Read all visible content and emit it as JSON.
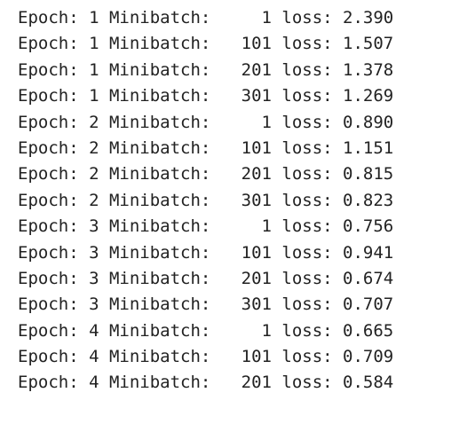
{
  "console": {
    "lines": [
      "Epoch: 1 Minibatch:     1 loss: 2.390",
      "Epoch: 1 Minibatch:   101 loss: 1.507",
      "Epoch: 1 Minibatch:   201 loss: 1.378",
      "Epoch: 1 Minibatch:   301 loss: 1.269",
      "Epoch: 2 Minibatch:     1 loss: 0.890",
      "Epoch: 2 Minibatch:   101 loss: 1.151",
      "Epoch: 2 Minibatch:   201 loss: 0.815",
      "Epoch: 2 Minibatch:   301 loss: 0.823",
      "Epoch: 3 Minibatch:     1 loss: 0.756",
      "Epoch: 3 Minibatch:   101 loss: 0.941",
      "Epoch: 3 Minibatch:   201 loss: 0.674",
      "Epoch: 3 Minibatch:   301 loss: 0.707",
      "Epoch: 4 Minibatch:     1 loss: 0.665",
      "Epoch: 4 Minibatch:   101 loss: 0.709",
      "Epoch: 4 Minibatch:   201 loss: 0.584"
    ]
  }
}
